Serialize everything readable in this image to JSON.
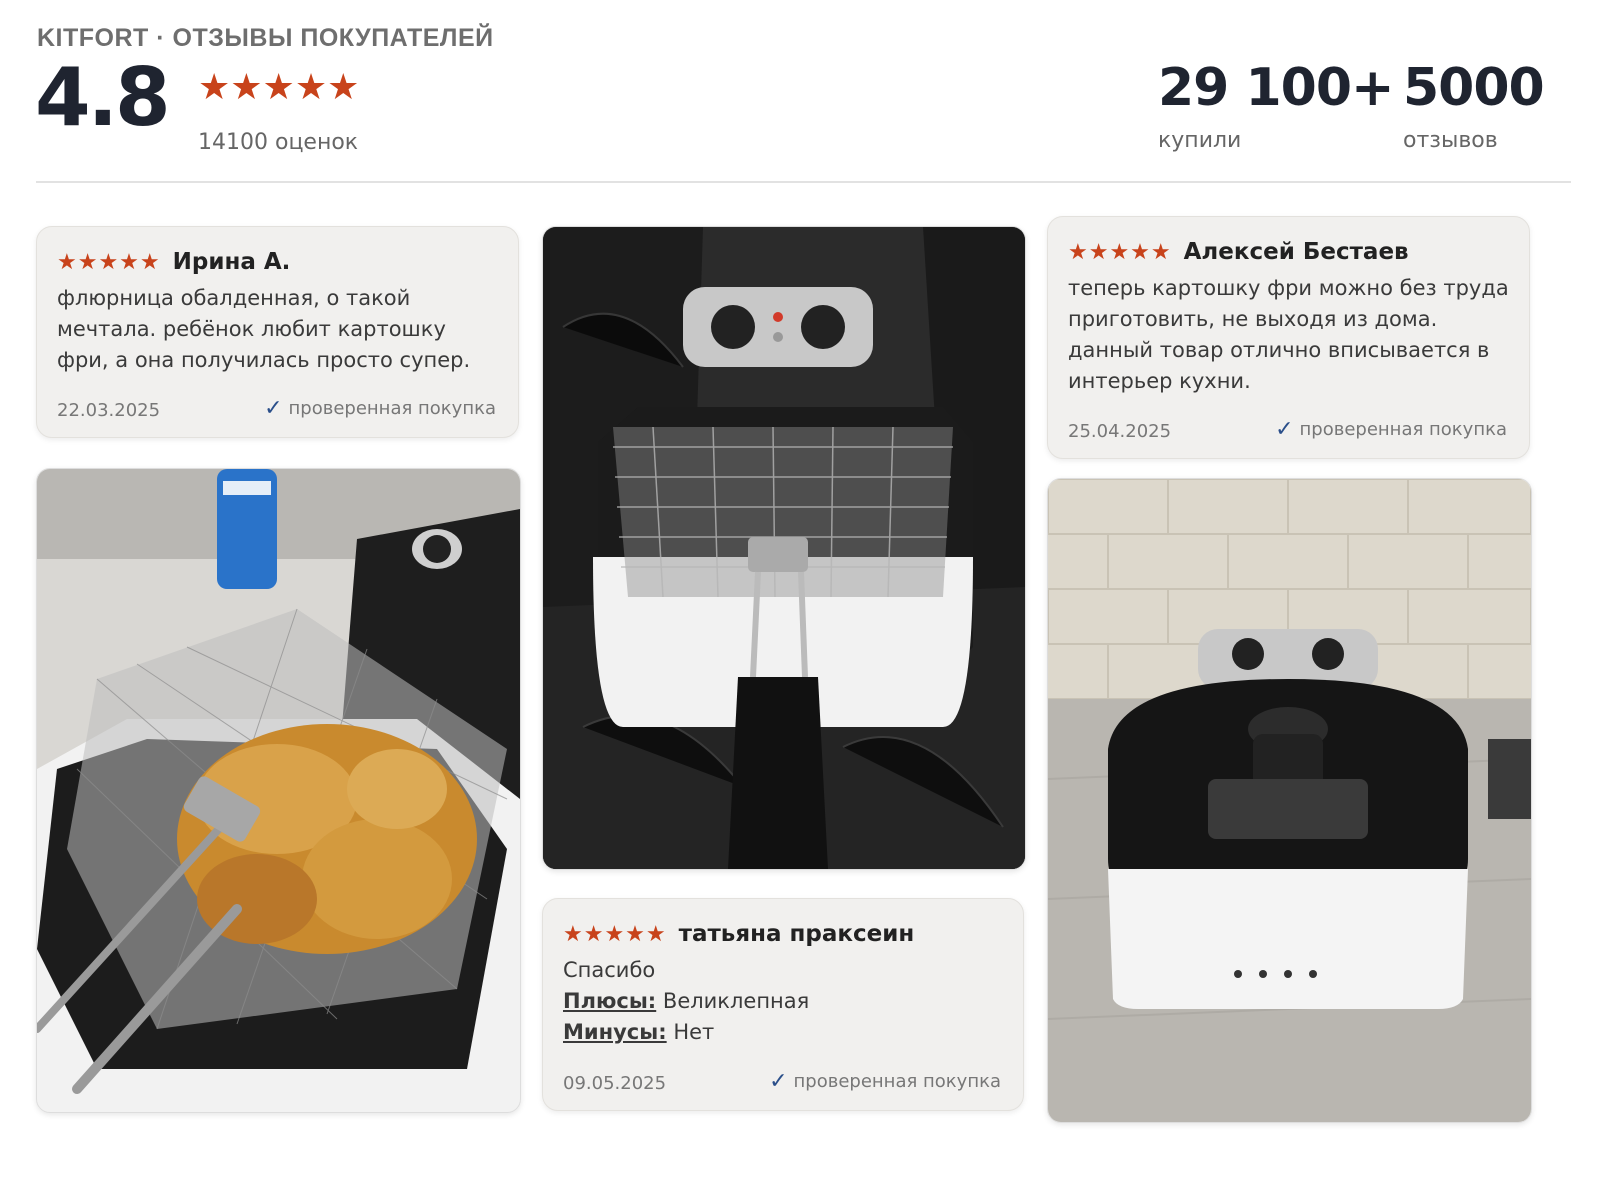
{
  "header": {
    "brand": "KITFORT · ОТЗЫВЫ ПОКУПАТЕЛЕЙ",
    "rating": "4.8",
    "stars": "★★★★★",
    "ratings_count": "14100 оценок",
    "stats": [
      {
        "value": "29 100+",
        "label": "купили"
      },
      {
        "value": "5000",
        "label": "отзывов"
      }
    ]
  },
  "reviews": [
    {
      "stars": "★★★★★",
      "author": "Ирина А.",
      "text": "флюрница обалденная, о такой мечтала. ребёнок любит картошку фри, а она получилась просто супер.",
      "date": "22.03.2025",
      "verified": "проверенная покупка"
    },
    {
      "stars": "★★★★★",
      "author": "Алексей Бестаев",
      "text": "теперь картошку фри можно без труда приготовить, не выходя из дома. данный товар отлично вписывается в интерьер кухни.",
      "date": "25.04.2025",
      "verified": "проверенная покупка"
    },
    {
      "stars": "★★★★★",
      "author": "татьяна праксеин",
      "text": "Спасибо",
      "pros_label": "Плюсы:",
      "pros": "Великлепная",
      "cons_label": "Минусы:",
      "cons": "Нет",
      "date": "09.05.2025",
      "verified": "проверенная покупка"
    }
  ],
  "icons": {
    "star": "star-icon",
    "check": "check-icon"
  },
  "colors": {
    "star": "#c8431b",
    "check": "#2b4f8a",
    "card_bg": "#f1f0ee"
  }
}
